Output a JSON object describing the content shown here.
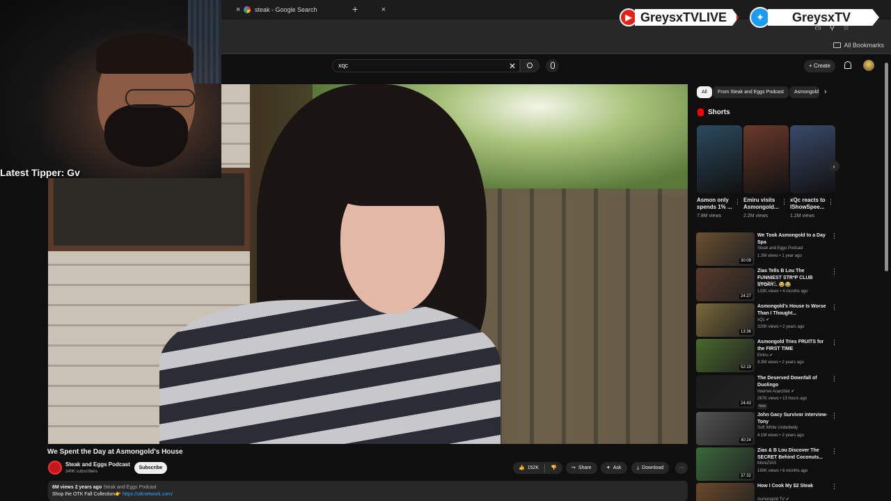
{
  "browser": {
    "tabs": [
      {
        "title": "steak - Google Search",
        "close": "×"
      }
    ],
    "new_tab": "+",
    "bookmarks_label": "All Bookmarks"
  },
  "overlay": {
    "youtube_handle": "GreysxTVLIVE",
    "twitter_handle": "GreysxTV",
    "latest_tipper": "Latest Tipper: Gv"
  },
  "header": {
    "search_value": "xqc",
    "create_label": "Create"
  },
  "video": {
    "title": "We Spent the Day at Asmongold's House",
    "channel": "Steak and Eggs Podcast",
    "subscribers": "340K subscribers",
    "subscribe_label": "Subscribe",
    "likes": "152K",
    "share_label": "Share",
    "ask_label": "Ask",
    "download_label": "Download",
    "more": "···",
    "views": "6M views",
    "age": "2 years ago",
    "desc_channel": "Steak and Eggs Podcast",
    "desc_text": "Shop the OTK Fall Collection👉",
    "desc_link": "https://otknetwork.com/"
  },
  "sidebar": {
    "chips": [
      "All",
      "From Steak and Eggs Podcast",
      "Asmongold"
    ],
    "chip_next": "›",
    "shorts_label": "Shorts",
    "shorts": [
      {
        "title": "Asmon only spends 1% ...",
        "views": "7.8M views",
        "color": "#2b4a5e"
      },
      {
        "title": "Emiru visits Asmongold...",
        "views": "2.2M views",
        "color": "#6a3a2a"
      },
      {
        "title": "xQc reacts to IShowSpee...",
        "views": "1.2M views",
        "color": "#3a4a6a"
      }
    ],
    "recommendations": [
      {
        "title": "We Took Asmongold to a Day Spa",
        "channel": "Steak and Eggs Podcast",
        "meta": "1.3M views • 1 year ago",
        "duration": "30:09",
        "color": "#6a5030"
      },
      {
        "title": "Zias Tells B Lou The FUNNIEST STR*P CLUB STORY... 😂😂",
        "channel": "MoreZIAS",
        "meta": "133K views • 4 months ago",
        "duration": "24:27",
        "color": "#5a3a2a"
      },
      {
        "title": "Asmongold's House Is Worse Than I Thought...",
        "channel": "xQc ✔",
        "meta": "320K views • 2 years ago",
        "duration": "13:36",
        "color": "#7a6a3a"
      },
      {
        "title": "Asmongold Tries FRUITS for the FIRST TIME",
        "channel": "Emiru ✔",
        "meta": "3.3M views • 2 years ago",
        "duration": "52:19",
        "color": "#4a6a2a"
      },
      {
        "title": "The Deserved Downfall of Duolingo",
        "channel": "Internet Anarchist ✔",
        "meta": "267K views • 13 hours ago",
        "new": "New",
        "duration": "24:43",
        "color": "#1a1a1a"
      },
      {
        "title": "John Gacy Survivor interview- Tony",
        "channel": "Soft White Underbelly",
        "meta": "4.1M views • 2 years ago",
        "duration": "40:24",
        "color": "#555555"
      },
      {
        "title": "Zias & B Lou Discover The SECRET Behind Coconuts...",
        "channel": "MoreZIAS",
        "meta": "190K views • 6 months ago",
        "duration": "37:32",
        "color": "#3a6a3a"
      },
      {
        "title": "How I Cook My $2 Steak",
        "channel": "Asmongold TV ✔",
        "meta": "",
        "duration": "",
        "color": "#6a4a2a"
      }
    ]
  }
}
